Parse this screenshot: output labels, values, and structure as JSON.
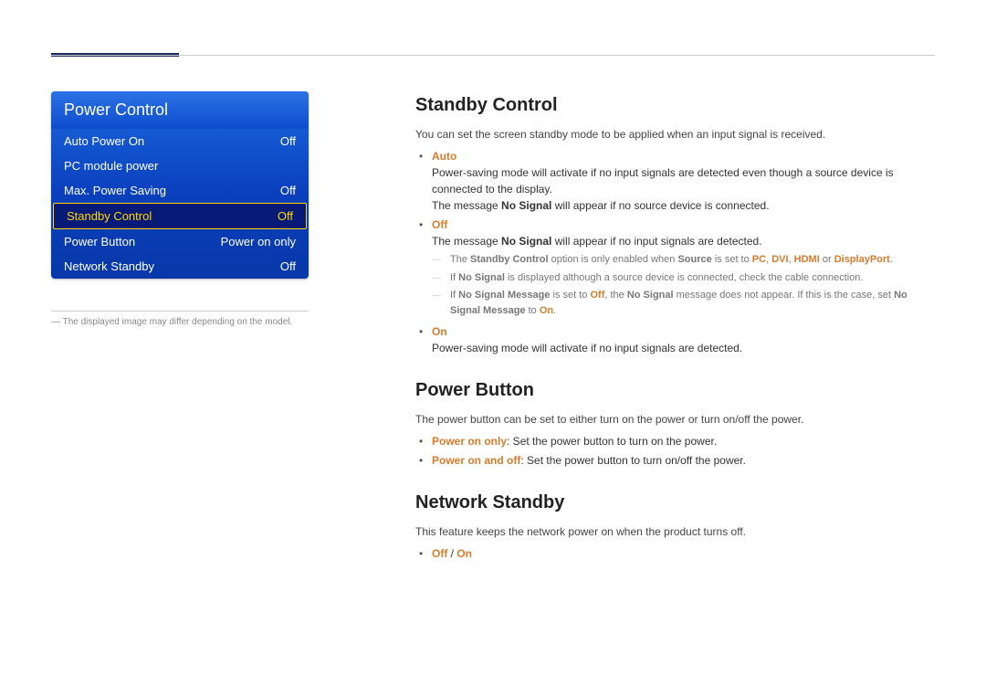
{
  "menu": {
    "title": "Power Control",
    "items": [
      {
        "label": "Auto Power On",
        "value": "Off",
        "selected": false
      },
      {
        "label": "PC module power",
        "value": "",
        "selected": false
      },
      {
        "label": "Max. Power Saving",
        "value": "Off",
        "selected": false
      },
      {
        "label": "Standby Control",
        "value": "Off",
        "selected": true
      },
      {
        "label": "Power Button",
        "value": "Power on only",
        "selected": false
      },
      {
        "label": "Network Standby",
        "value": "Off",
        "selected": false
      }
    ],
    "note_prefix": "―",
    "note": "The displayed image may differ depending on the model."
  },
  "sections": {
    "standby": {
      "heading": "Standby Control",
      "intro": "You can set the screen standby mode to be applied when an input signal is received.",
      "auto_label": "Auto",
      "auto_line1a": "Power-saving mode will activate if no input signals are detected even though a source device is connected to the display.",
      "auto_line2_pre": "The message ",
      "auto_line2_b": "No Signal",
      "auto_line2_post": " will appear if no source device is connected.",
      "off_label": "Off",
      "off_line_pre": "The message ",
      "off_line_b": "No Signal",
      "off_line_post": " will appear if no input signals are detected.",
      "dash1_pre": "The ",
      "dash1_b1": "Standby Control",
      "dash1_mid": " option is only enabled when ",
      "dash1_b2": "Source",
      "dash1_mid2": " is set to ",
      "dash1_h1": "PC",
      "dash1_c1": ", ",
      "dash1_h2": "DVI",
      "dash1_c2": ", ",
      "dash1_h3": "HDMI",
      "dash1_c3": " or ",
      "dash1_h4": "DisplayPort",
      "dash1_end": ".",
      "dash2_pre": "If ",
      "dash2_b": "No Signal",
      "dash2_post": " is displayed although a source device is connected, check the cable connection.",
      "dash3_pre": "If ",
      "dash3_b1": "No Signal Message",
      "dash3_mid1": " is set to ",
      "dash3_h1": "Off",
      "dash3_mid2": ", the ",
      "dash3_b2": "No Signal",
      "dash3_mid3": " message does not appear. If this is the case, set ",
      "dash3_b3": "No Signal Message",
      "dash3_mid4": " to ",
      "dash3_h2": "On",
      "dash3_end": ".",
      "on_label": "On",
      "on_line": "Power-saving mode will activate if no input signals are detected."
    },
    "powerbtn": {
      "heading": "Power Button",
      "intro": "The power button can be set to either turn on the power or turn on/off the power.",
      "opt1_h": "Power on only",
      "opt1_t": ": Set the power button to turn on the power.",
      "opt2_h": "Power on and off",
      "opt2_t": ": Set the power button to turn on/off the power."
    },
    "net": {
      "heading": "Network Standby",
      "intro": "This feature keeps the network power on when the product turns off.",
      "opt_off": "Off",
      "opt_sep": " / ",
      "opt_on": "On"
    }
  }
}
